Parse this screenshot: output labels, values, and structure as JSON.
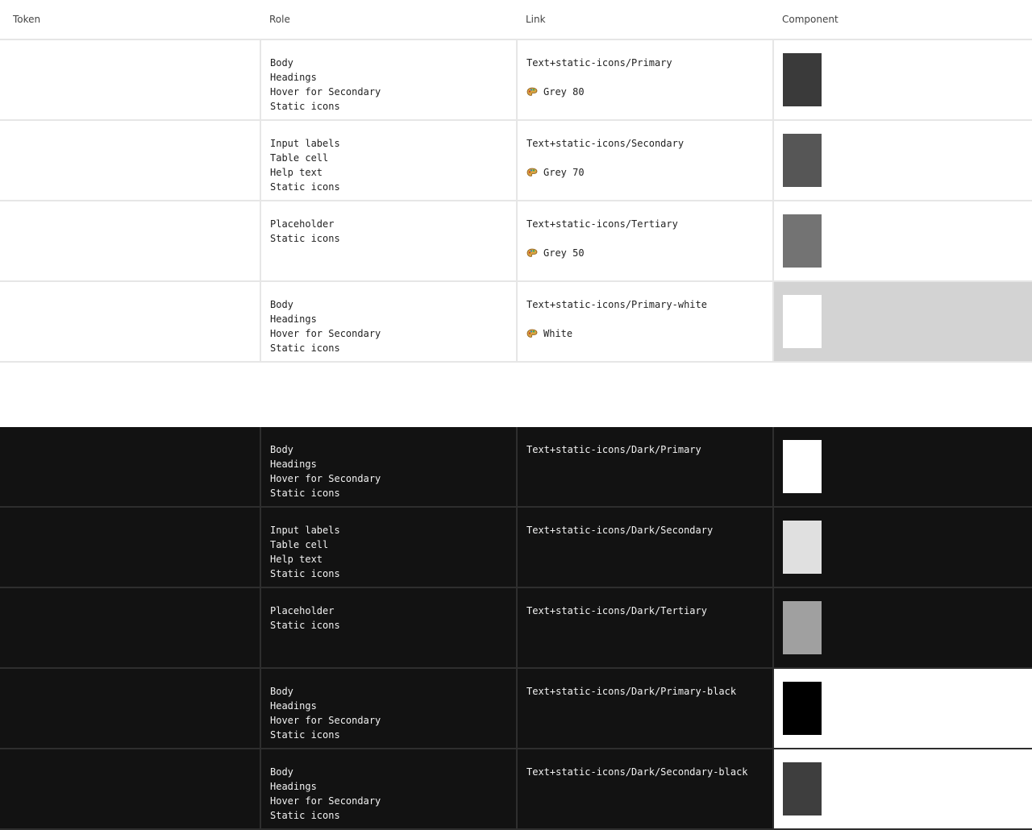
{
  "header": {
    "token": "Token",
    "role": "Role",
    "link": "Link",
    "component": "Component"
  },
  "light_rows": [
    {
      "roles": [
        "Body",
        "Headings",
        "Hover for Secondary",
        "Static icons"
      ],
      "link": "Text+static-icons/Primary",
      "ref": "Grey 80",
      "swatch_color": "#3a3a3a",
      "cell_bg": "#ffffff"
    },
    {
      "roles": [
        "Input labels",
        "Table cell",
        "Help text",
        "Static icons"
      ],
      "link": "Text+static-icons/Secondary",
      "ref": "Grey 70",
      "swatch_color": "#565656",
      "cell_bg": "#ffffff"
    },
    {
      "roles": [
        "Placeholder",
        "Static icons"
      ],
      "link": "Text+static-icons/Tertiary",
      "ref": "Grey 50",
      "swatch_color": "#737373",
      "cell_bg": "#ffffff"
    },
    {
      "roles": [
        "Body",
        "Headings",
        "Hover for Secondary",
        "Static icons"
      ],
      "link": "Text+static-icons/Primary-white",
      "ref": "White",
      "swatch_color": "#ffffff",
      "cell_bg": "#d3d3d3"
    }
  ],
  "dark_rows": [
    {
      "roles": [
        "Body",
        "Headings",
        "Hover for Secondary",
        "Static icons"
      ],
      "link": "Text+static-icons/Dark/Primary",
      "swatch_color": "#ffffff",
      "cell_bg": "#121212"
    },
    {
      "roles": [
        "Input labels",
        "Table cell",
        "Help text",
        "Static icons"
      ],
      "link": "Text+static-icons/Dark/Secondary",
      "swatch_color": "#e0e0e0",
      "cell_bg": "#121212"
    },
    {
      "roles": [
        "Placeholder",
        "Static icons"
      ],
      "link": "Text+static-icons/Dark/Tertiary",
      "swatch_color": "#a0a0a0",
      "cell_bg": "#121212"
    },
    {
      "roles": [
        "Body",
        "Headings",
        "Hover for Secondary",
        "Static icons"
      ],
      "link": "Text+static-icons/Dark/Primary-black",
      "swatch_color": "#000000",
      "cell_bg": "#ffffff"
    },
    {
      "roles": [
        "Body",
        "Headings",
        "Hover for Secondary",
        "Static icons"
      ],
      "link": "Text+static-icons/Dark/Secondary-black",
      "swatch_color": "#3e3e3e",
      "cell_bg": "#ffffff"
    }
  ],
  "icons": {
    "reference": "palette-icon"
  }
}
